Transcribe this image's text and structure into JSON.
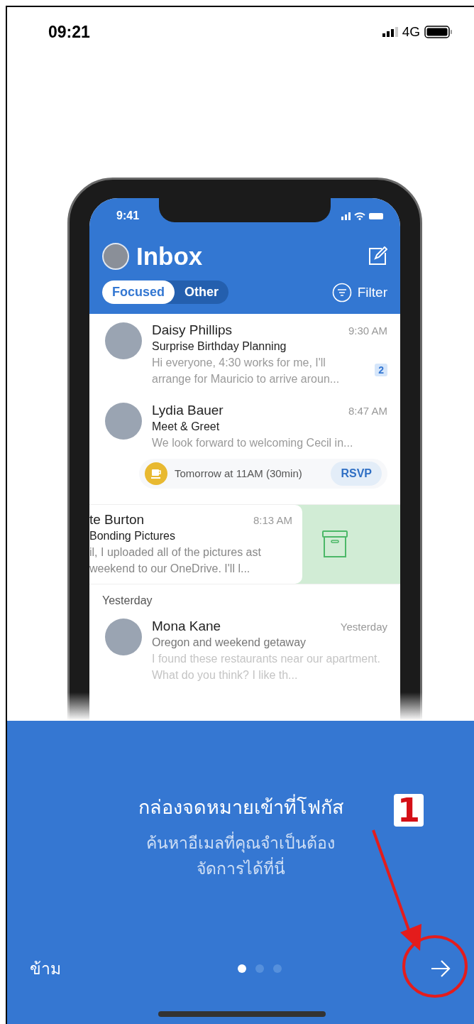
{
  "status_bar": {
    "time": "09:21",
    "network": "4G"
  },
  "illustration": {
    "status_time": "9:41",
    "title": "Inbox",
    "filter_label": "Filter",
    "tabs": [
      {
        "label": "Focused",
        "selected": true
      },
      {
        "label": "Other",
        "selected": false
      }
    ],
    "emails": [
      {
        "kind": "message",
        "sender": "Daisy Phillips",
        "time": "9:30 AM",
        "subject": "Surprise Birthday Planning",
        "preview": "Hi everyone, 4:30 works for me, I'll arrange for Mauricio to arrive aroun...",
        "count": "2"
      },
      {
        "kind": "message",
        "sender": "Lydia Bauer",
        "time": "8:47 AM",
        "subject": "Meet & Greet",
        "preview": "We look forward to welcoming Cecil in...",
        "event": {
          "text": "Tomorrow at 11AM (30min)",
          "action": "RSVP"
        }
      },
      {
        "kind": "swiped",
        "sender": "te Burton",
        "time": "8:13 AM",
        "subject": "Bonding Pictures",
        "preview": "il, I uploaded all of the pictures ast weekend to our OneDrive. I'll l..."
      },
      {
        "kind": "section",
        "label": "Yesterday"
      },
      {
        "kind": "message",
        "sender": "Mona Kane",
        "time": "Yesterday",
        "subject": "Oregon and weekend getaway",
        "preview": "I found these restaurants near our apartment. What do you think? I like th..."
      }
    ]
  },
  "onboarding": {
    "title": "กล่องจดหมายเข้าที่โฟกัส",
    "description": "ค้นหาอีเมลที่คุณจำเป็นต้องจัดการได้ที่นี่",
    "skip": "ข้าม",
    "pages": [
      {
        "selected": true
      },
      {
        "selected": false
      },
      {
        "selected": false
      }
    ]
  },
  "annotation": {
    "label": "1"
  }
}
